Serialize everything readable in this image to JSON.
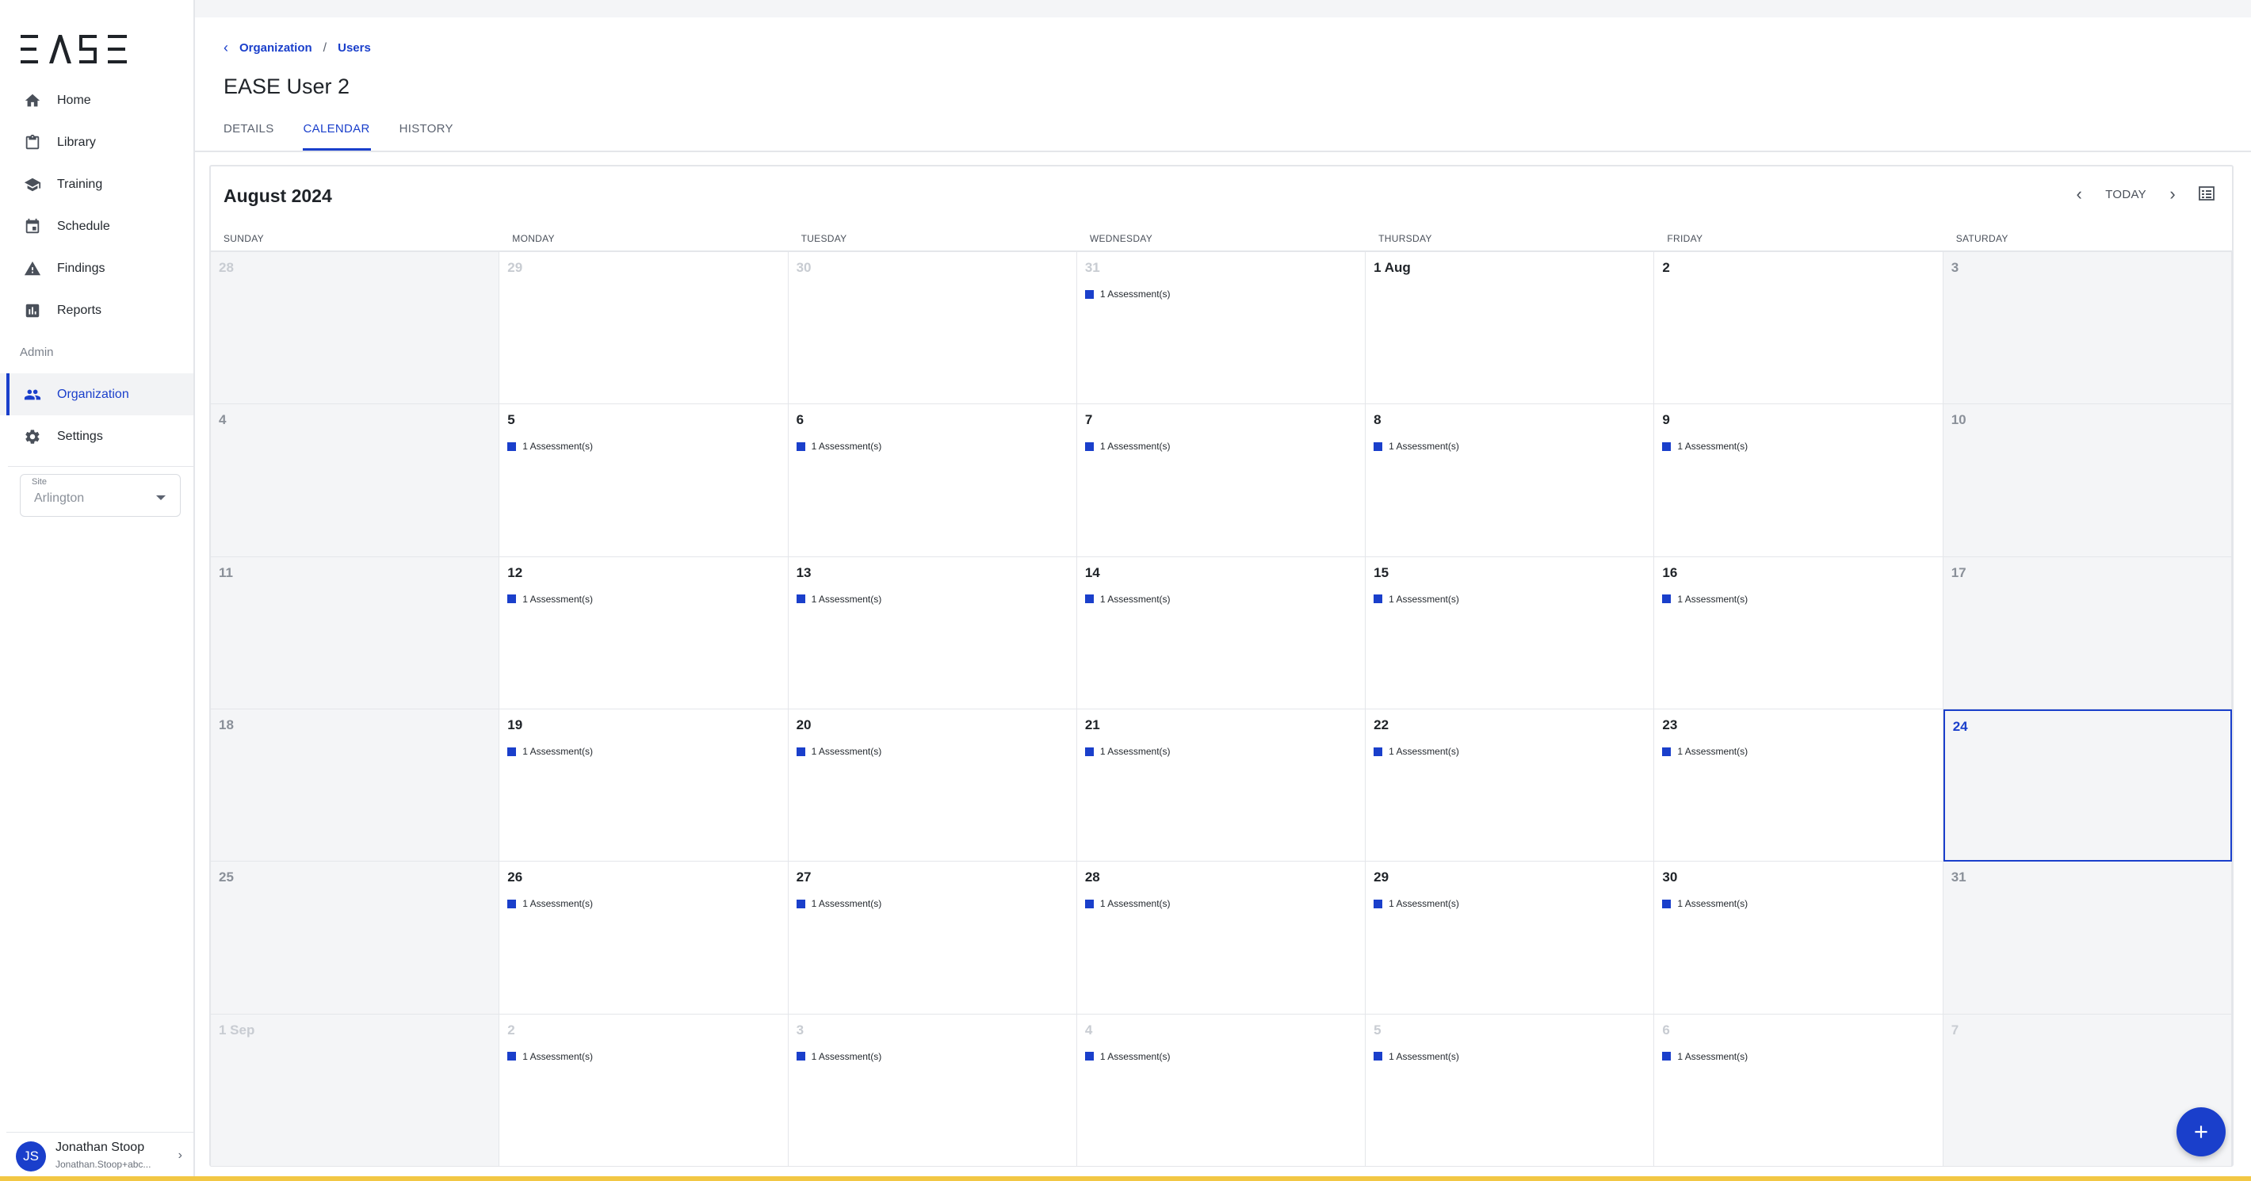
{
  "app": {
    "logo_text": "EASE"
  },
  "sidebar": {
    "items": [
      {
        "label": "Home",
        "icon": "home-icon"
      },
      {
        "label": "Library",
        "icon": "clipboard-icon"
      },
      {
        "label": "Training",
        "icon": "graduation-cap-icon"
      },
      {
        "label": "Schedule",
        "icon": "calendar-icon"
      },
      {
        "label": "Findings",
        "icon": "warning-icon"
      },
      {
        "label": "Reports",
        "icon": "bar-chart-icon"
      }
    ],
    "admin_label": "Admin",
    "admin_items": [
      {
        "label": "Organization",
        "icon": "people-icon",
        "active": true
      },
      {
        "label": "Settings",
        "icon": "gear-icon"
      }
    ],
    "site": {
      "label": "Site",
      "value": "Arlington"
    },
    "user": {
      "initials": "JS",
      "name": "Jonathan Stoop",
      "email": "Jonathan.Stoop+abc..."
    }
  },
  "breadcrumb": {
    "items": [
      "Organization",
      "Users"
    ],
    "separator": "/"
  },
  "page_title": "EASE User 2",
  "tabs": [
    {
      "label": "DETAILS",
      "active": false
    },
    {
      "label": "CALENDAR",
      "active": true
    },
    {
      "label": "HISTORY",
      "active": false
    }
  ],
  "calendar": {
    "month_title": "August 2024",
    "today_label": "TODAY",
    "weekdays": [
      "SUNDAY",
      "MONDAY",
      "TUESDAY",
      "WEDNESDAY",
      "THURSDAY",
      "FRIDAY",
      "SATURDAY"
    ],
    "event_label": "1 Assessment(s)",
    "weeks": [
      [
        {
          "d": "28",
          "out": true
        },
        {
          "d": "29",
          "out": true
        },
        {
          "d": "30",
          "out": true
        },
        {
          "d": "31",
          "out": true,
          "ev": true
        },
        {
          "d": "1 Aug"
        },
        {
          "d": "2"
        },
        {
          "d": "3"
        }
      ],
      [
        {
          "d": "4"
        },
        {
          "d": "5",
          "ev": true
        },
        {
          "d": "6",
          "ev": true
        },
        {
          "d": "7",
          "ev": true
        },
        {
          "d": "8",
          "ev": true
        },
        {
          "d": "9",
          "ev": true
        },
        {
          "d": "10"
        }
      ],
      [
        {
          "d": "11"
        },
        {
          "d": "12",
          "ev": true
        },
        {
          "d": "13",
          "ev": true
        },
        {
          "d": "14",
          "ev": true
        },
        {
          "d": "15",
          "ev": true
        },
        {
          "d": "16",
          "ev": true
        },
        {
          "d": "17"
        }
      ],
      [
        {
          "d": "18"
        },
        {
          "d": "19",
          "ev": true
        },
        {
          "d": "20",
          "ev": true
        },
        {
          "d": "21",
          "ev": true
        },
        {
          "d": "22",
          "ev": true
        },
        {
          "d": "23",
          "ev": true
        },
        {
          "d": "24",
          "today": true
        }
      ],
      [
        {
          "d": "25"
        },
        {
          "d": "26",
          "ev": true
        },
        {
          "d": "27",
          "ev": true
        },
        {
          "d": "28",
          "ev": true
        },
        {
          "d": "29",
          "ev": true
        },
        {
          "d": "30",
          "ev": true
        },
        {
          "d": "31"
        }
      ],
      [
        {
          "d": "1 Sep",
          "out": true
        },
        {
          "d": "2",
          "out": true,
          "ev": true
        },
        {
          "d": "3",
          "out": true,
          "ev": true
        },
        {
          "d": "4",
          "out": true,
          "ev": true
        },
        {
          "d": "5",
          "out": true,
          "ev": true
        },
        {
          "d": "6",
          "out": true,
          "ev": true
        },
        {
          "d": "7",
          "out": true
        }
      ]
    ]
  },
  "colors": {
    "accent": "#1a3fcb",
    "weekend_bg": "#f4f5f7",
    "border": "#e4e6ea"
  }
}
